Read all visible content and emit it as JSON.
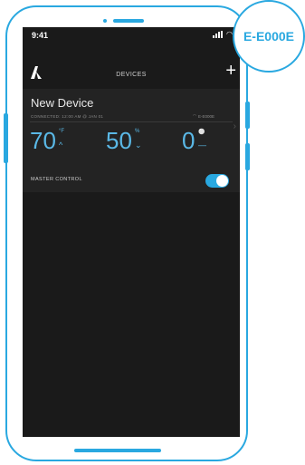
{
  "status_bar": {
    "time": "9:41"
  },
  "nav": {
    "title": "DEVICES",
    "add_icon": "plus-icon",
    "logo": "A"
  },
  "device": {
    "name": "New Device",
    "connected_text": "CONNECTED: 12:00 AM @ JAN 01",
    "device_id": "E-E000E",
    "readings": [
      {
        "value": "70",
        "unit": "°F",
        "control": "^"
      },
      {
        "value": "50",
        "unit": "%",
        "control": "⌄"
      },
      {
        "value": "0",
        "unit": "⚪",
        "control": "—"
      }
    ]
  },
  "master_control": {
    "label": "MASTER CONTROL",
    "enabled": true
  },
  "badge": {
    "text": "E-E000E"
  },
  "colors": {
    "accent": "#29a8e0",
    "screen_bg": "#1a1a1a",
    "card_bg": "#232323"
  }
}
